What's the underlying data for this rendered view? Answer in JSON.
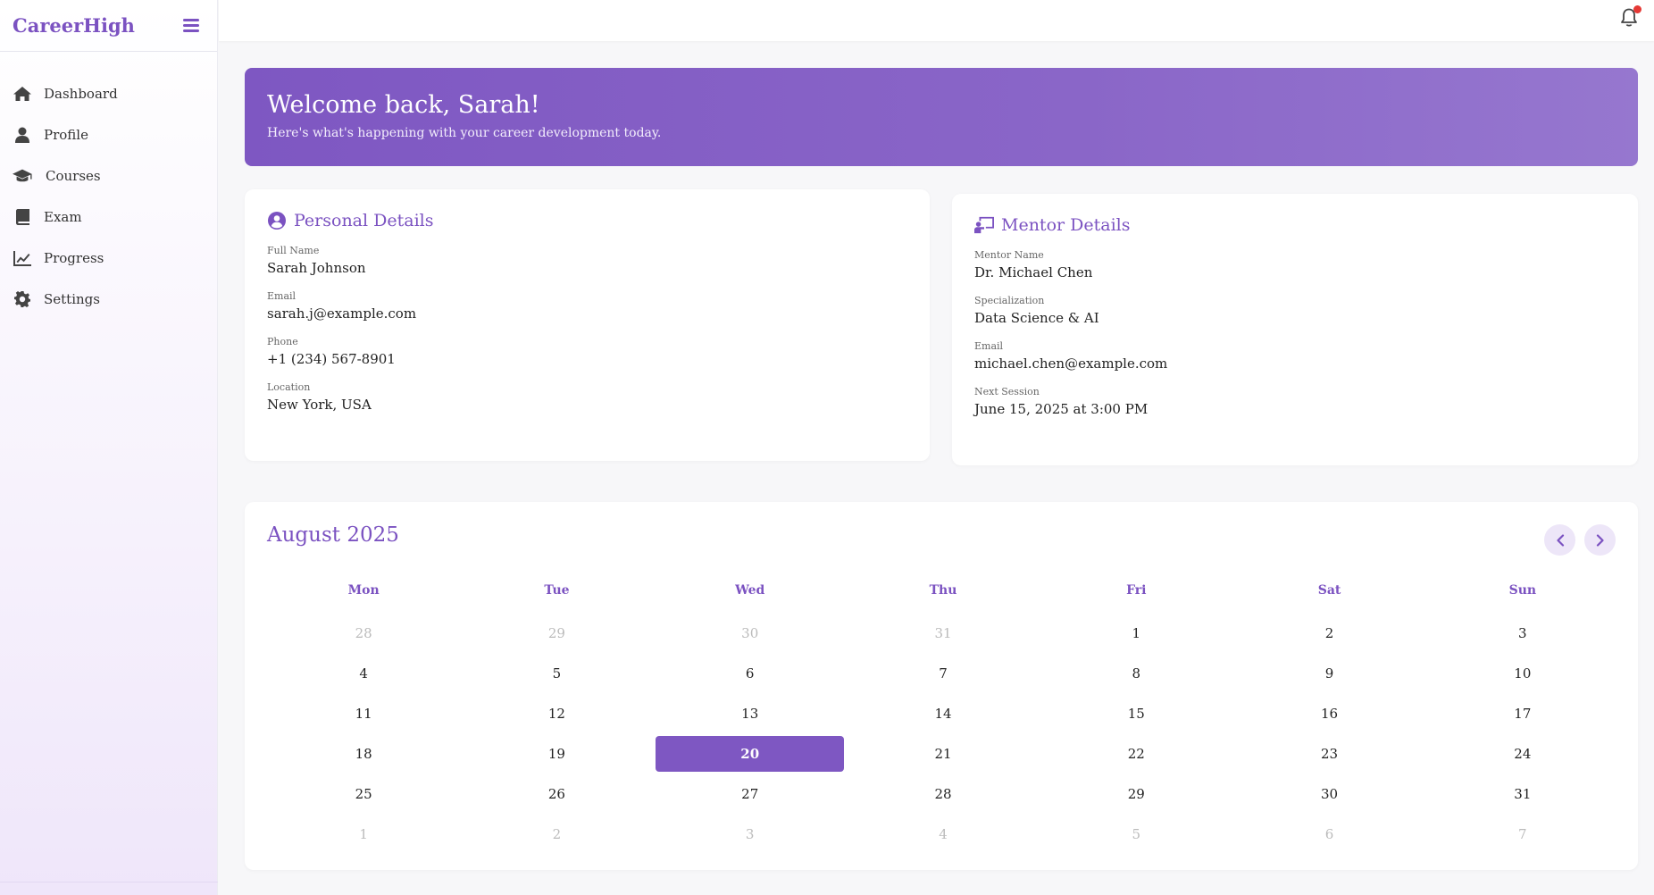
{
  "brand": "CareerHigh",
  "nav": [
    {
      "label": "Dashboard",
      "icon": "home-icon"
    },
    {
      "label": "Profile",
      "icon": "user-icon"
    },
    {
      "label": "Courses",
      "icon": "graduation-cap-icon"
    },
    {
      "label": "Exam",
      "icon": "book-icon"
    },
    {
      "label": "Progress",
      "icon": "chart-line-icon"
    },
    {
      "label": "Settings",
      "icon": "gear-icon"
    }
  ],
  "banner": {
    "title": "Welcome back, Sarah!",
    "subtitle": "Here's what's happening with your career development today."
  },
  "personal": {
    "title": "Personal Details",
    "fields": [
      {
        "label": "Full Name",
        "value": "Sarah Johnson"
      },
      {
        "label": "Email",
        "value": "sarah.j@example.com"
      },
      {
        "label": "Phone",
        "value": "+1 (234) 567-8901"
      },
      {
        "label": "Location",
        "value": "New York, USA"
      }
    ]
  },
  "mentor": {
    "title": "Mentor Details",
    "fields": [
      {
        "label": "Mentor Name",
        "value": "Dr. Michael Chen"
      },
      {
        "label": "Specialization",
        "value": "Data Science & AI"
      },
      {
        "label": "Email",
        "value": "michael.chen@example.com"
      },
      {
        "label": "Next Session",
        "value": "June 15, 2025 at 3:00 PM"
      }
    ]
  },
  "calendar": {
    "title": "August 2025",
    "weekdays": [
      "Mon",
      "Tue",
      "Wed",
      "Thu",
      "Fri",
      "Sat",
      "Sun"
    ],
    "weeks": [
      [
        "28",
        "29",
        "30",
        "31",
        "1",
        "2",
        "3"
      ],
      [
        "4",
        "5",
        "6",
        "7",
        "8",
        "9",
        "10"
      ],
      [
        "11",
        "12",
        "13",
        "14",
        "15",
        "16",
        "17"
      ],
      [
        "18",
        "19",
        "20",
        "21",
        "22",
        "23",
        "24"
      ],
      [
        "25",
        "26",
        "27",
        "28",
        "29",
        "30",
        "31"
      ],
      [
        "1",
        "2",
        "3",
        "4",
        "5",
        "6",
        "7"
      ]
    ],
    "muted": [
      [
        0,
        0
      ],
      [
        0,
        1
      ],
      [
        0,
        2
      ],
      [
        0,
        3
      ],
      [
        5,
        0
      ],
      [
        5,
        1
      ],
      [
        5,
        2
      ],
      [
        5,
        3
      ],
      [
        5,
        4
      ],
      [
        5,
        5
      ],
      [
        5,
        6
      ]
    ],
    "today": "20"
  },
  "colors": {
    "accent": "#7b52c1",
    "notification": "#e53935"
  }
}
